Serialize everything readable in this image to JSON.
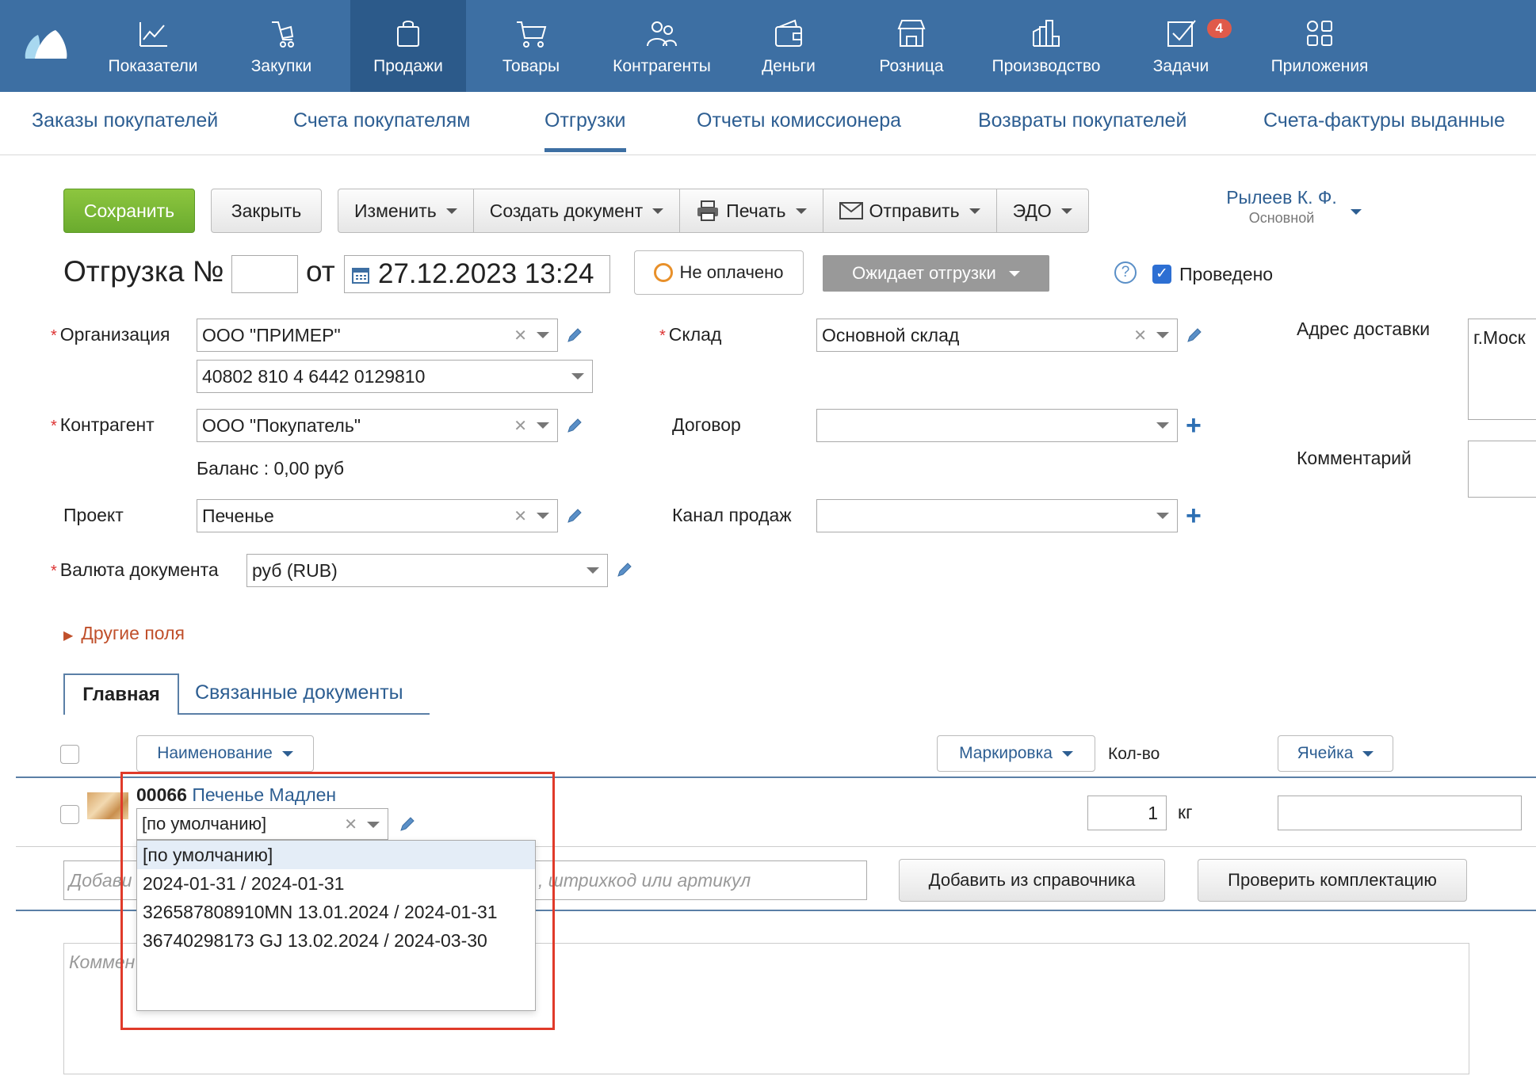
{
  "nav": {
    "items": [
      {
        "label": "Показатели",
        "icon": "chart-icon"
      },
      {
        "label": "Закупки",
        "icon": "purchase-icon"
      },
      {
        "label": "Продажи",
        "icon": "bag-icon",
        "active": true
      },
      {
        "label": "Товары",
        "icon": "cart-icon"
      },
      {
        "label": "Контрагенты",
        "icon": "people-icon"
      },
      {
        "label": "Деньги",
        "icon": "wallet-icon"
      },
      {
        "label": "Розница",
        "icon": "store-icon"
      },
      {
        "label": "Производство",
        "icon": "factory-icon"
      },
      {
        "label": "Задачи",
        "icon": "tasks-icon",
        "badge": "4"
      },
      {
        "label": "Приложения",
        "icon": "apps-icon"
      }
    ]
  },
  "subnav": {
    "items": [
      "Заказы покупателей",
      "Счета покупателям",
      "Отгрузки",
      "Отчеты комиссионера",
      "Возвраты покупателей",
      "Счета-фактуры выданные"
    ],
    "active": "Отгрузки"
  },
  "toolbar": {
    "save": "Сохранить",
    "close": "Закрыть",
    "edit": "Изменить",
    "create_doc": "Создать документ",
    "print": "Печать",
    "send": "Отправить",
    "edo": "ЭДО"
  },
  "user": {
    "name": "Рылеев К. Ф.",
    "role": "Основной"
  },
  "doc": {
    "title": "Отгрузка №",
    "number": "",
    "from": "от",
    "date": "27.12.2023 13:24",
    "payment_status": "Не оплачено",
    "shipment_status": "Ожидает отгрузки",
    "posted_label": "Проведено",
    "posted": true
  },
  "form": {
    "org_label": "Организация",
    "org_value": "ООО \"ПРИМЕР\"",
    "account_value": "40802 810 4 6442 0129810",
    "contractor_label": "Контрагент",
    "contractor_value": "ООО \"Покупатель\"",
    "balance": "Баланс : 0,00 руб",
    "project_label": "Проект",
    "project_value": "Печенье",
    "currency_label": "Валюта документа",
    "currency_value": "руб (RUB)",
    "warehouse_label": "Склад",
    "warehouse_value": "Основной склад",
    "contract_label": "Договор",
    "contract_value": "",
    "channel_label": "Канал продаж",
    "channel_value": "",
    "address_label": "Адрес доставки",
    "address_value": "г.Моск",
    "comment_label": "Комментарий",
    "other_fields": "Другие поля"
  },
  "tabs": {
    "main": "Главная",
    "linked": "Связанные документы"
  },
  "table": {
    "col_name": "Наименование",
    "col_marking": "Маркировка",
    "col_qty": "Кол-во",
    "col_cell": "Ячейка",
    "row": {
      "code": "00066",
      "name": "Печенье Мадлен",
      "batch_value": "[по умолчанию]",
      "qty": "1",
      "unit": "кг",
      "cell": ""
    },
    "add_placeholder_start": "Добави",
    "add_placeholder_end": ", штрихкод или артикул",
    "add_from_catalog": "Добавить из справочника",
    "check_kit": "Проверить комплектацию",
    "comment_placeholder": "Коммен"
  },
  "batch_dropdown": {
    "options": [
      "[по умолчанию]",
      "2024-01-31 / 2024-01-31",
      "326587808910MN 13.01.2024 / 2024-01-31",
      "36740298173 GJ 13.02.2024 / 2024-03-30"
    ]
  },
  "colors": {
    "nav_bg": "#3d6fa3",
    "accent": "#2d5e92",
    "save_green": "#7bb935",
    "highlight_red": "#e03a2a",
    "link_orange": "#c0502b"
  }
}
